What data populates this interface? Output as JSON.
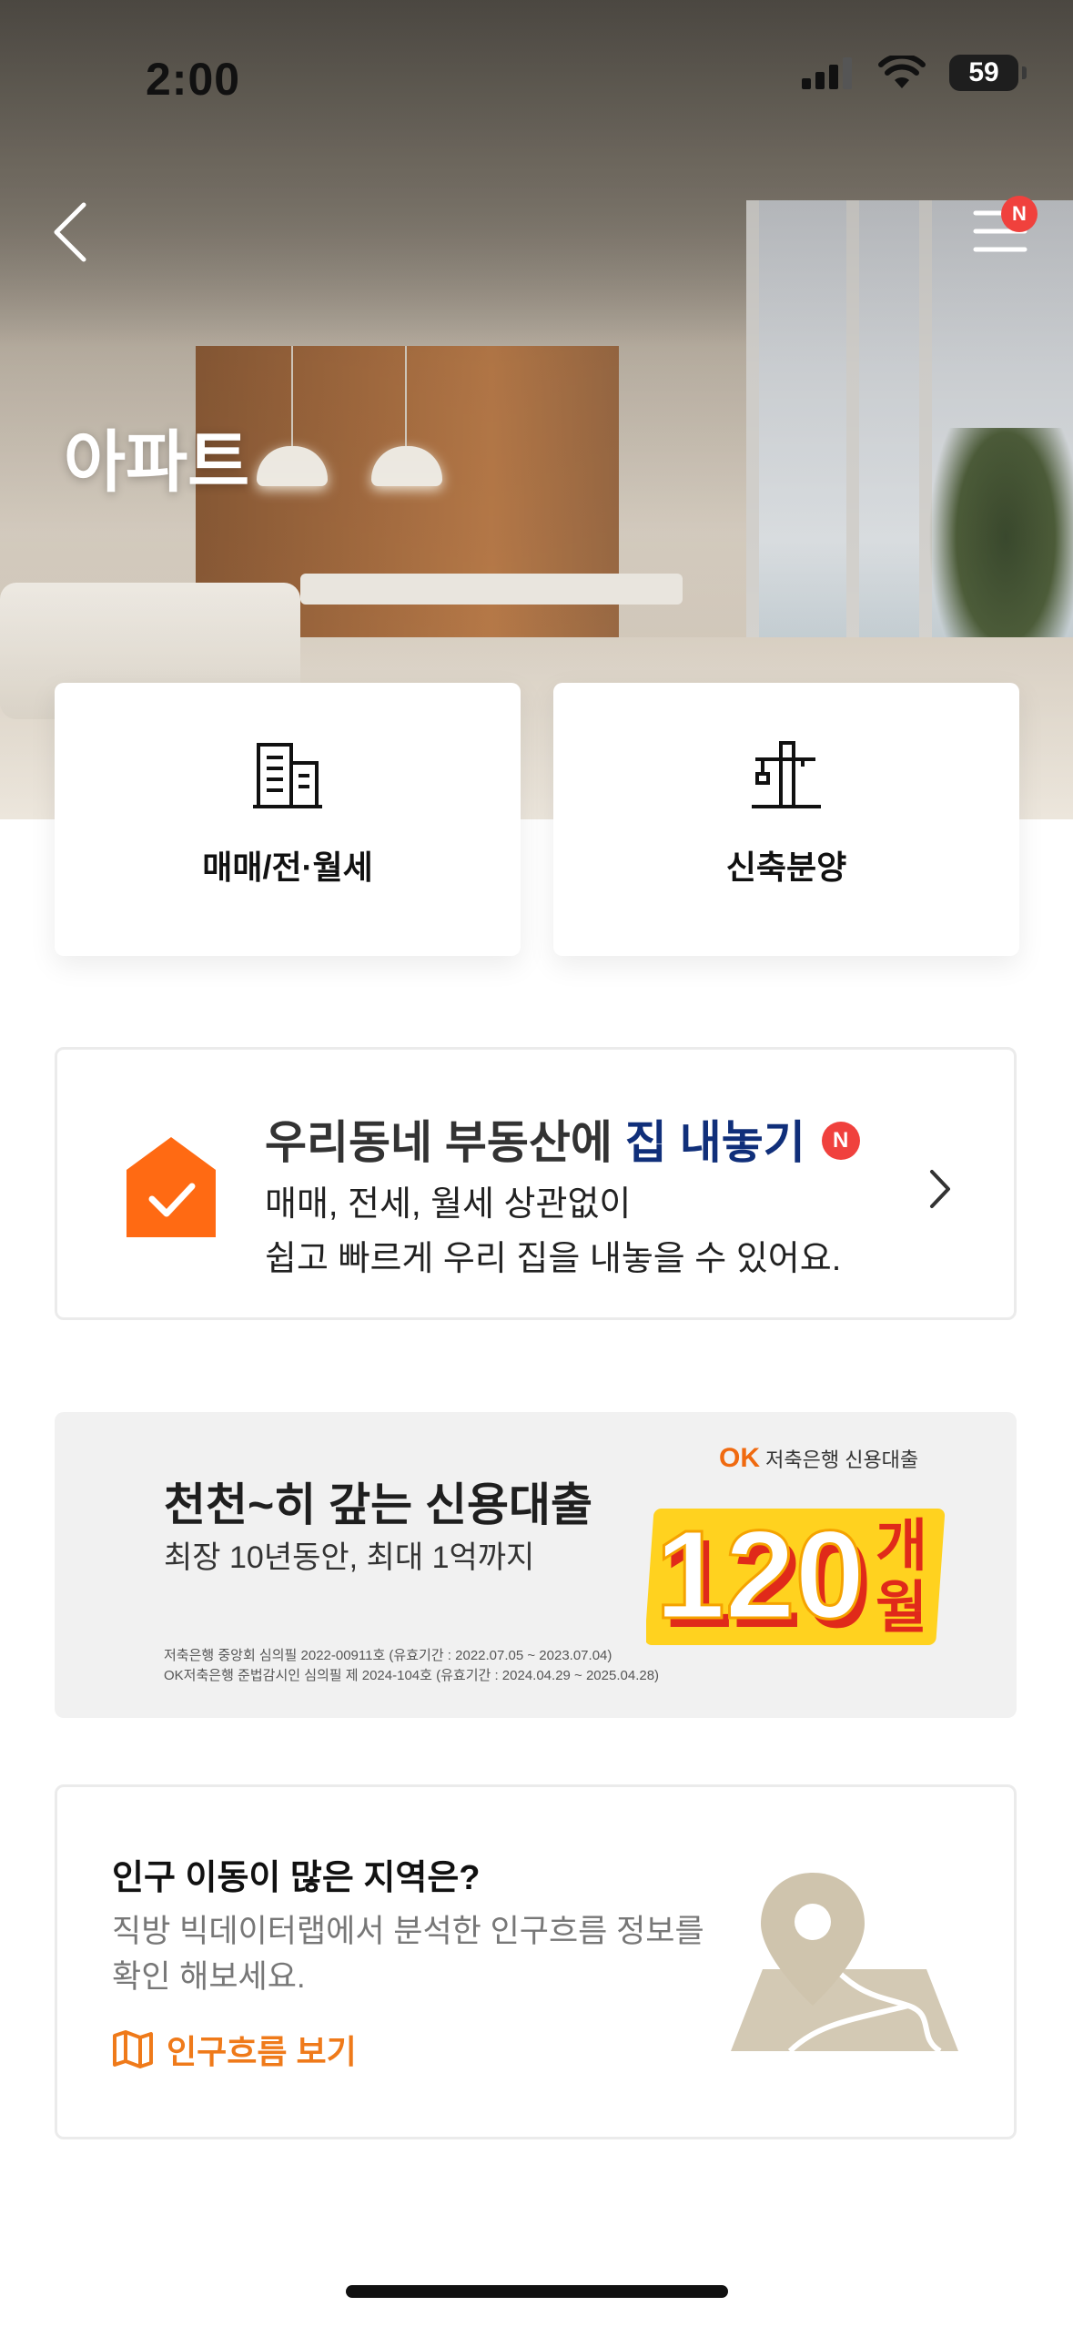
{
  "status_bar": {
    "time": "2:00",
    "battery_level": "59"
  },
  "nav": {
    "back_icon": "chevron-left-icon",
    "menu_icon": "menu-icon",
    "menu_badge": "N"
  },
  "page": {
    "title": "아파트"
  },
  "categories": [
    {
      "label": "매매/전·월세",
      "icon": "building-icon"
    },
    {
      "label": "신축분양",
      "icon": "crane-icon"
    }
  ],
  "listing_banner": {
    "title_prefix": "우리동네 부동산에 ",
    "title_highlight": "집 내놓기",
    "badge": "N",
    "line1": "매매, 전세, 월세 상관없이",
    "line2": "쉽고 빠르게 우리 집을 내놓을 수 있어요.",
    "accent_color": "#ff6a13",
    "highlight_color": "#102f7a"
  },
  "ad_banner": {
    "brand_mark": "OK",
    "brand_text": "저축은행 신용대출",
    "headline": "천천~히 갚는 신용대출",
    "subline": "최장 10년동안, 최대 1억까지",
    "big_number": "120",
    "big_unit_top": "개",
    "big_unit_bottom": "월",
    "fine_print_1": "저축은행 중앙회 심의필 2022-00911호 (유효기간 : 2022.07.05 ~ 2023.07.04)",
    "fine_print_2": "OK저축은행 준법감시인 심의필 제 2024-104호 (유효기간 : 2024.04.29 ~ 2025.04.28)"
  },
  "population_card": {
    "title": "인구 이동이 많은 지역은?",
    "desc_line1": "직방 빅데이터랩에서 분석한 인구흐름 정보를",
    "desc_line2": "확인 해보세요.",
    "link_label": "인구흐름 보기",
    "link_icon": "map-icon",
    "link_color": "#ef7a1a",
    "illustration": "map-pin-icon"
  }
}
